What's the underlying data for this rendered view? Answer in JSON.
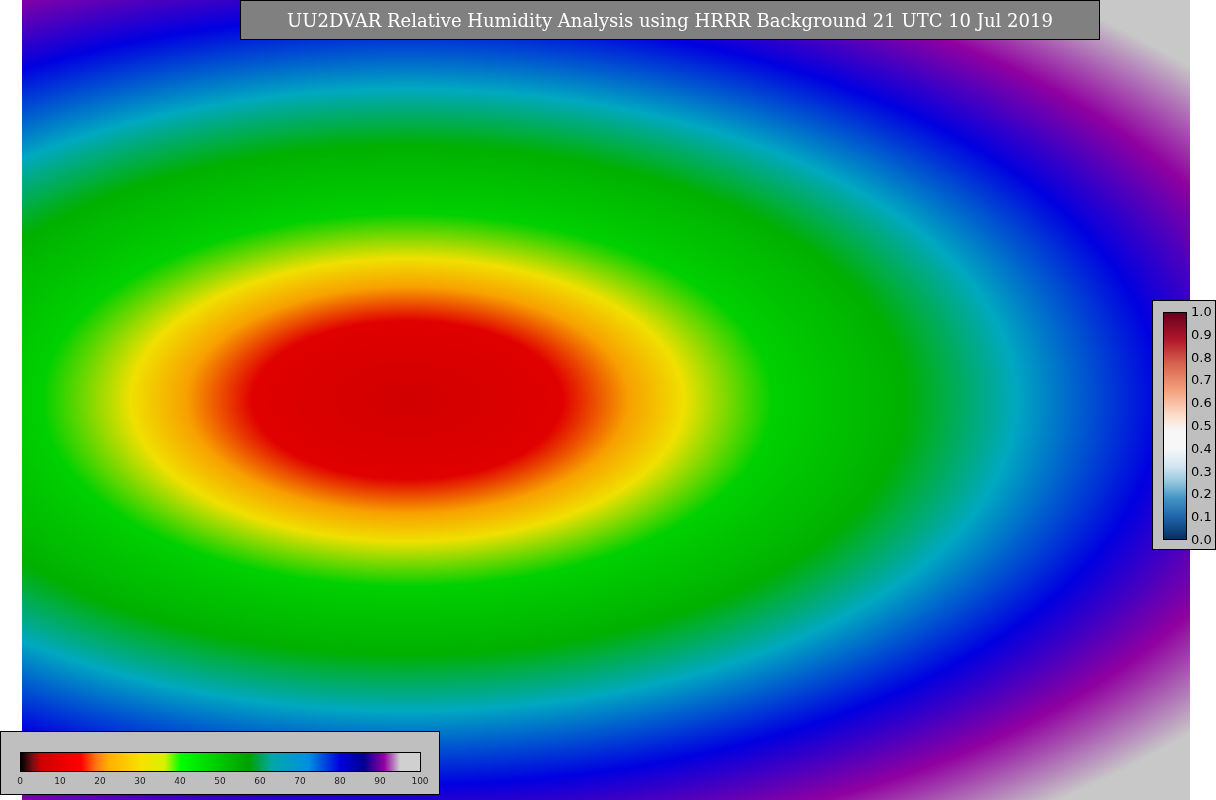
{
  "title": "UU2DVAR Relative Humidity Analysis using HRRR Background 21 UTC 10 Jul 2019",
  "humidity_colorbar": {
    "ticks": [
      "0",
      "10",
      "20",
      "30",
      "40",
      "50",
      "60",
      "70",
      "80",
      "90",
      "100"
    ]
  },
  "ratio_colorbar": {
    "ticks": [
      "1.0",
      "0.9",
      "0.8",
      "0.7",
      "0.6",
      "0.5",
      "0.4",
      "0.3",
      "0.2",
      "0.1",
      "0.0"
    ]
  }
}
